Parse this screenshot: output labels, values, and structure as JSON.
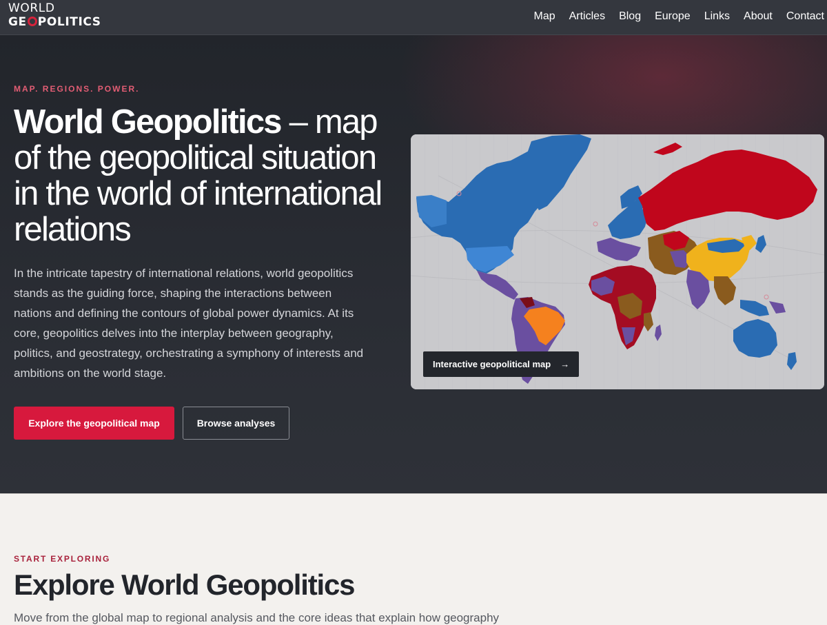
{
  "brand": {
    "logo_top": "WORLD",
    "logo_bottom_pre": "GE",
    "logo_bottom_post": "POLITICS",
    "accent_color": "#d7193d"
  },
  "nav": {
    "items": [
      {
        "label": "Map"
      },
      {
        "label": "Articles"
      },
      {
        "label": "Blog"
      },
      {
        "label": "Europe"
      },
      {
        "label": "Links"
      },
      {
        "label": "About"
      },
      {
        "label": "Contact"
      }
    ]
  },
  "hero": {
    "kicker": "MAP. REGIONS. POWER.",
    "title_bold": "World Geopolitics",
    "title_rest": " – map of the geopolitical situation in the world of international relations",
    "body": "In the intricate tapestry of international relations, world geopolitics stands as the guiding force, shaping the interactions between nations and defining the contours of global power dynamics. At its core, geopolitics delves into the interplay between geography, politics, and geostrategy, orchestrating a symphony of interests and ambitions on the world stage.",
    "primary_button": "Explore the geopolitical map",
    "secondary_button": "Browse analyses",
    "map_badge": "Interactive geopolitical map",
    "map_badge_arrow": "→",
    "map_bloc_colors": {
      "western": "#2a6cb3",
      "russia": "#c0061c",
      "china": "#f0b21c",
      "brazil": "#f5811e",
      "contested": "#6a4fa0",
      "neutral_brown": "#8a5b1e",
      "ocean": "#c9c9cc"
    }
  },
  "explore": {
    "kicker": "START EXPLORING",
    "title": "Explore World Geopolitics",
    "text": "Move from the global map to regional analysis and the core ideas that explain how geography"
  }
}
